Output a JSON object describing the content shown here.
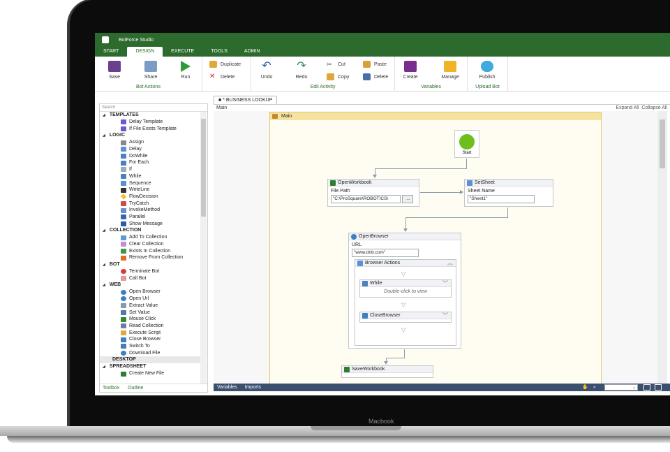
{
  "device": {
    "brand": "Macbook"
  },
  "app": {
    "title": "BotForce Studio"
  },
  "menu": [
    "START",
    "DESIGN",
    "EXECUTE",
    "TOOLS",
    "ADMIN"
  ],
  "ribbon": {
    "bot_actions": {
      "label": "Bot Actions",
      "save": "Save",
      "share": "Share",
      "run": "Run",
      "duplicate": "Duplicate",
      "delete": "Delete"
    },
    "edit_activity": {
      "label": "Edit Activity",
      "undo": "Undo",
      "redo": "Redo",
      "cut": "Cut",
      "copy": "Copy",
      "paste": "Paste",
      "delete": "Delete"
    },
    "variables": {
      "label": "Variables",
      "create": "Create",
      "manage": "Manage"
    },
    "upload_bot": {
      "label": "Upload Bot",
      "publish": "Publish"
    }
  },
  "toolbox": {
    "search_placeholder": "Search",
    "footer_tabs": [
      "Toolbox",
      "Outline"
    ],
    "categories": [
      {
        "name": "TEMPLATES",
        "items": [
          "Delay Template",
          "If File Exists Template"
        ]
      },
      {
        "name": "LOGIC",
        "items": [
          "Assign",
          "Delay",
          "DoWhile",
          "For Each",
          "If",
          "While",
          "Sequence",
          "WriteLine",
          "FlowDecision",
          "TryCatch",
          "InvokeMethod",
          "Parallel",
          "Show Message"
        ]
      },
      {
        "name": "COLLECTION",
        "items": [
          "Add To Collection",
          "Clear Collection",
          "Exists In Collection",
          "Remove From Collection"
        ]
      },
      {
        "name": "BOT",
        "items": [
          "Terminate Bot",
          "Call Bot"
        ]
      },
      {
        "name": "WEB",
        "items": [
          "Open Browser",
          "Open Url",
          "Extract Value",
          "Set Value",
          "Mouse Click",
          "Read Collection",
          "Execute Script",
          "Close Browser",
          "Switch To",
          "Download File"
        ]
      },
      {
        "name": "DESKTOP",
        "items": []
      },
      {
        "name": "SPREADSHEET",
        "items": [
          "Create New File"
        ]
      }
    ]
  },
  "designer": {
    "tab": "* BUSINESS LOOKUP",
    "breadcrumb": "Main",
    "expand_all": "Expand All",
    "collapse_all": "Collapse All",
    "sequence_title": "Main",
    "start_label": "Start",
    "open_workbook": {
      "title": "OpenWorkbook",
      "field_label": "File Path",
      "value": "\"C:\\ProSquare\\ROBOTICS\\",
      "browse": "..."
    },
    "set_sheet": {
      "title": "SetSheet",
      "field_label": "Sheet Name",
      "value": "\"Sheet1\""
    },
    "open_browser": {
      "title": "OpenBrowser",
      "field_label": "URL",
      "value": "\"www.dnb.com\""
    },
    "browser_actions": {
      "title": "Browser Actions"
    },
    "while_block": {
      "title": "While",
      "hint": "Double-click to view"
    },
    "close_browser": {
      "title": "CloseBrowser"
    },
    "save_workbook": {
      "title": "SaveWorkbook"
    }
  },
  "statusbar": {
    "variables": "Variables",
    "imports": "Imports"
  },
  "colors": {
    "brand_green": "#2d6a2d",
    "status_bar": "#3b4f6e",
    "sequence_header": "#f7e3a1"
  }
}
